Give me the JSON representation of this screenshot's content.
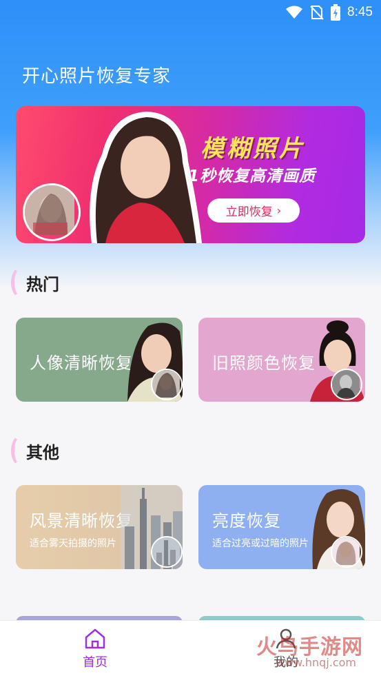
{
  "status_bar": {
    "time": "8:45"
  },
  "header": {
    "title": "开心照片恢复专家"
  },
  "banner": {
    "headline": "模糊照片",
    "subline": "1秒恢复高清画质",
    "button_label": "立即恢复"
  },
  "sections": {
    "hot": {
      "title": "热门",
      "cards": [
        {
          "title": "人像清晰恢复",
          "color": "#86a98c"
        },
        {
          "title": "旧照颜色恢复",
          "color": "#e3a6cf"
        }
      ]
    },
    "other": {
      "title": "其他",
      "cards": [
        {
          "title": "风景清晰恢复",
          "desc": "适合雾天拍摄的照片",
          "color": "#e2c7a2"
        },
        {
          "title": "亮度恢复",
          "desc": "适合过亮或过暗的照片",
          "color": "#8fb0f0"
        }
      ]
    }
  },
  "bottom_nav": {
    "items": [
      {
        "label": "首页",
        "icon": "home-icon",
        "active": true
      },
      {
        "label": "我的",
        "icon": "user-icon",
        "active": false
      }
    ],
    "active_color": "#9b2fe3"
  },
  "watermark": {
    "text": "火鸟手游网",
    "url": "www.hnqj.com"
  }
}
